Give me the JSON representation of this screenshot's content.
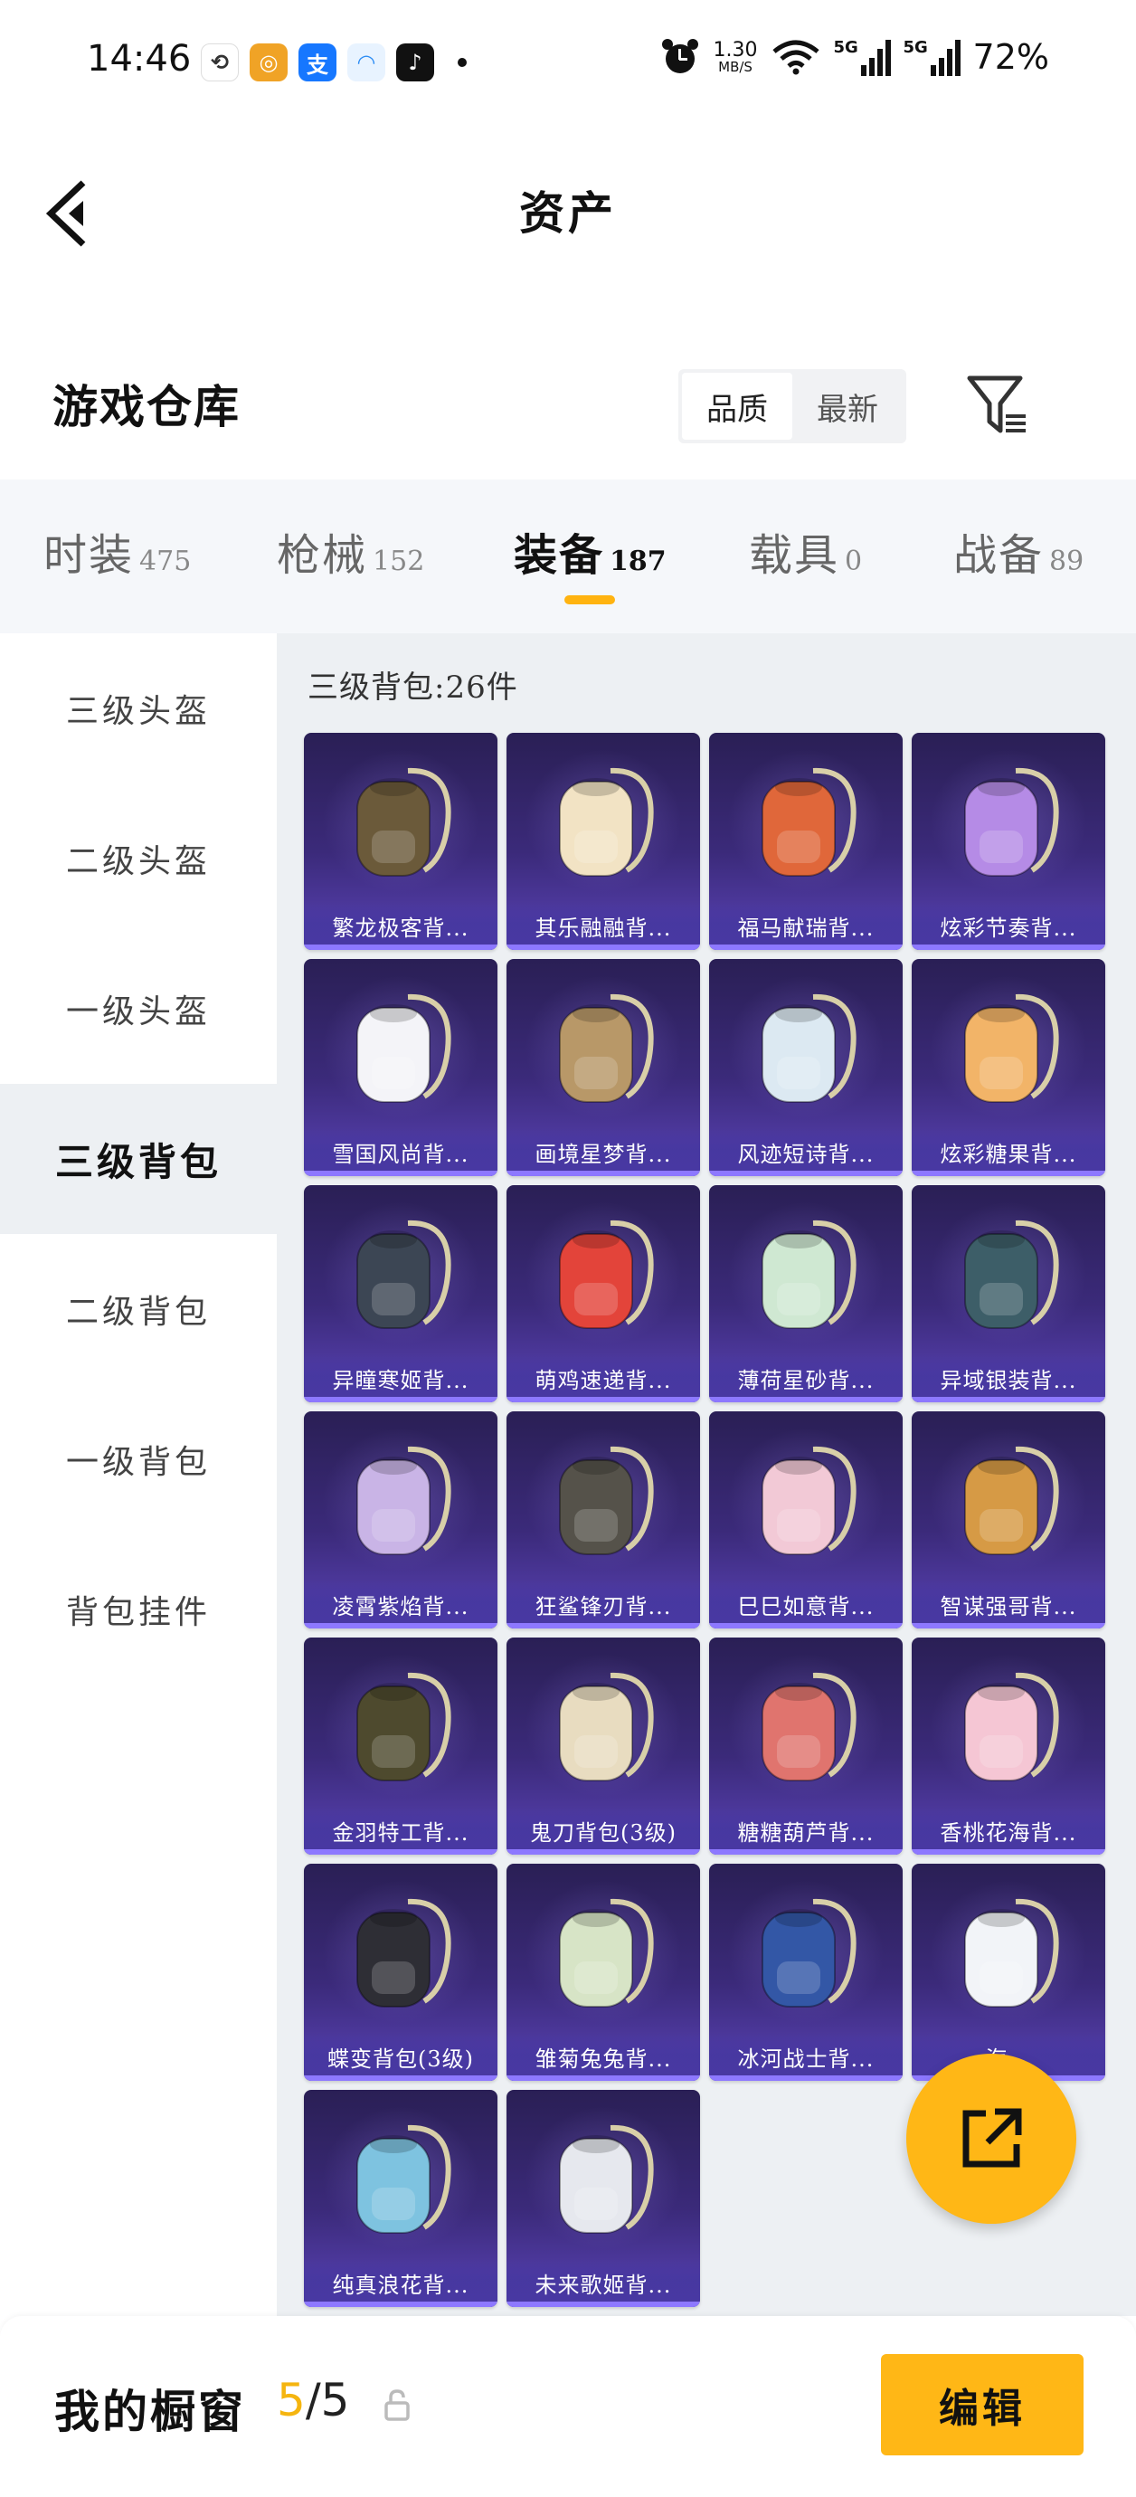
{
  "status_bar": {
    "time": "14:46",
    "net_speed_value": "1.30",
    "net_speed_unit": "MB/S",
    "signal1_label": "5G",
    "signal2_label": "5G",
    "battery": "72%",
    "app_icons": [
      "link-app-icon",
      "target-app-icon",
      "alipay-icon",
      "cloud-app-icon",
      "tiktok-icon"
    ]
  },
  "header": {
    "title": "资产"
  },
  "warehouse": {
    "title": "游戏仓库",
    "sort_options": [
      "品质",
      "最新"
    ],
    "active_sort": "品质"
  },
  "tabs": [
    {
      "label": "时装",
      "count": "475"
    },
    {
      "label": "枪械",
      "count": "152"
    },
    {
      "label": "装备",
      "count": "187"
    },
    {
      "label": "载具",
      "count": "0"
    },
    {
      "label": "战备",
      "count": "89"
    }
  ],
  "active_tab": "装备",
  "sidebar": {
    "items": [
      "三级头盔",
      "二级头盔",
      "一级头盔",
      "三级背包",
      "二级背包",
      "一级背包",
      "背包挂件"
    ],
    "active": "三级背包"
  },
  "content": {
    "count_line": "三级背包:26件",
    "items": [
      {
        "name": "繁龙极客背...",
        "color": "#6b5a3a"
      },
      {
        "name": "其乐融融背...",
        "color": "#f2e3c4"
      },
      {
        "name": "福马献瑞背...",
        "color": "#e0673a"
      },
      {
        "name": "炫彩节奏背...",
        "color": "#b58be6"
      },
      {
        "name": "雪国风尚背...",
        "color": "#f4f4f8"
      },
      {
        "name": "画境星梦背...",
        "color": "#b89868"
      },
      {
        "name": "风迹短诗背...",
        "color": "#dce9f2"
      },
      {
        "name": "炫彩糖果背...",
        "color": "#f2b468"
      },
      {
        "name": "异瞳寒姬背...",
        "color": "#3c4654"
      },
      {
        "name": "萌鸡速递背...",
        "color": "#e3443a"
      },
      {
        "name": "薄荷星砂背...",
        "color": "#cfe8d2"
      },
      {
        "name": "异域银装背...",
        "color": "#3d5e68"
      },
      {
        "name": "凌霄紫焰背...",
        "color": "#c9b4e6"
      },
      {
        "name": "狂鲨锋刃背...",
        "color": "#55524a"
      },
      {
        "name": "巳巳如意背...",
        "color": "#f2c9d6"
      },
      {
        "name": "智谋强哥背...",
        "color": "#d69a45"
      },
      {
        "name": "金羽特工背...",
        "color": "#4e4a2e"
      },
      {
        "name": "鬼刀背包(3级)",
        "color": "#e8dcc0"
      },
      {
        "name": "糖糖葫芦背...",
        "color": "#e0746e"
      },
      {
        "name": "香桃花海背...",
        "color": "#f5c6d4"
      },
      {
        "name": "蝶变背包(3级)",
        "color": "#2e2e35"
      },
      {
        "name": "雏菊兔兔背...",
        "color": "#d7e4c6"
      },
      {
        "name": "冰河战士背...",
        "color": "#3357a6"
      },
      {
        "name": "海...",
        "color": "#f2f4f8"
      },
      {
        "name": "纯真浪花背...",
        "color": "#7ec3e0"
      },
      {
        "name": "未来歌姬背...",
        "color": "#e6e8ee"
      }
    ]
  },
  "share_button": {
    "icon": "share-external-icon"
  },
  "bottom_bar": {
    "label": "我的橱窗",
    "current": "5",
    "separator": "/",
    "total": "5",
    "edit_label": "编辑"
  },
  "colors": {
    "accent": "#ffb716",
    "card_top": "#2a1f55",
    "card_bottom": "#5a43b6"
  }
}
